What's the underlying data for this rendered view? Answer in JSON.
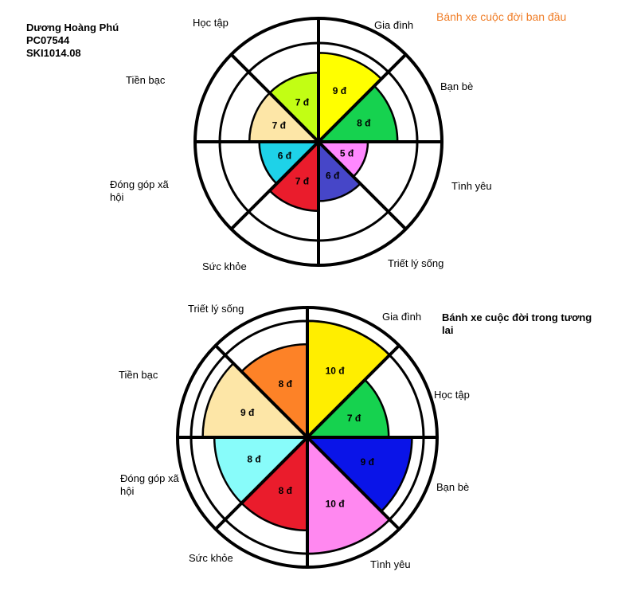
{
  "author": {
    "name": "Dương Hoàng Phú",
    "id": "PC07544",
    "class_code": "SKI1014.08"
  },
  "wheels": [
    {
      "title": "Bánh xe cuộc đời ban đầu",
      "segments": [
        {
          "label": "Gia đình",
          "score": 9,
          "score_text": "9 đ",
          "color": "#ffff00"
        },
        {
          "label": "Bạn bè",
          "score": 8,
          "score_text": "8 đ",
          "color": "#16d24f"
        },
        {
          "label": "Tình yêu",
          "score": 5,
          "score_text": "5 đ",
          "color": "#ff88ff"
        },
        {
          "label": "Triết lý sống",
          "score": 6,
          "score_text": "6 đ",
          "color": "#4646c8"
        },
        {
          "label": "Sức khỏe",
          "score": 7,
          "score_text": "7 đ",
          "color": "#ea1c2c"
        },
        {
          "label": "Đóng góp xã hội",
          "score": 6,
          "score_text": "6 đ",
          "color": "#1ed2e8"
        },
        {
          "label": "Tiền bạc",
          "score": 7,
          "score_text": "7 đ",
          "color": "#fde6a7"
        },
        {
          "label": "Học tập",
          "score": 7,
          "score_text": "7 đ",
          "color": "#c2fe14"
        }
      ]
    },
    {
      "title": "Bánh xe cuộc đời trong tương lai",
      "segments": [
        {
          "label": "Gia đình",
          "score": 10,
          "score_text": "10 đ",
          "color": "#ffee00"
        },
        {
          "label": "Học tập",
          "score": 7,
          "score_text": "7 đ",
          "color": "#16d24f"
        },
        {
          "label": "Bạn bè",
          "score": 9,
          "score_text": "9 đ",
          "color": "#0a14e8"
        },
        {
          "label": "Tình yêu",
          "score": 10,
          "score_text": "10 đ",
          "color": "#ff88f0"
        },
        {
          "label": "Sức khỏe",
          "score": 8,
          "score_text": "8 đ",
          "color": "#ea1c2c"
        },
        {
          "label": "Đóng góp xã hội",
          "score": 8,
          "score_text": "8 đ",
          "color": "#88fcfa"
        },
        {
          "label": "Tiền bạc",
          "score": 9,
          "score_text": "9 đ",
          "color": "#fde6a7"
        },
        {
          "label": "Triết lý sống",
          "score": 8,
          "score_text": "8 đ",
          "color": "#fd8227"
        }
      ]
    }
  ]
}
